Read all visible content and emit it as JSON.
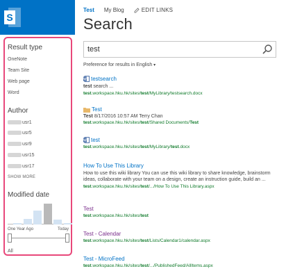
{
  "colors": {
    "brand": "#0072c6",
    "highlight": "#e8477a",
    "url": "#0f7a2a"
  },
  "header": {
    "nav": {
      "current": "Test",
      "blog": "My Blog",
      "edit": "EDIT LINKS"
    },
    "title": "Search"
  },
  "refiners": {
    "result_type": {
      "heading": "Result type",
      "items": [
        "OneNote",
        "Team Site",
        "Web page",
        "Word"
      ]
    },
    "author": {
      "heading": "Author",
      "items": [
        "usr1",
        "usr5",
        "usr9",
        "usr15",
        "usr17"
      ],
      "show_more": "SHOW MORE"
    },
    "modified": {
      "heading": "Modified date",
      "from": "One Year Ago",
      "to": "Today",
      "selection": "All",
      "histogram": [
        0.05,
        0.25,
        0.65,
        1.0,
        0.22,
        0.05
      ]
    }
  },
  "search": {
    "query": "test",
    "preference": "Preference for results in English"
  },
  "results": [
    {
      "icon": "word-doc-icon",
      "title": "testsearch",
      "desc": "test search ...",
      "url": [
        [
          "test",
          "b"
        ],
        [
          ".workspace.hku.hk/sites/",
          ""
        ],
        [
          "test",
          "b"
        ],
        [
          "/MyLibrary/testsearch.docx",
          ""
        ]
      ]
    },
    {
      "icon": "folder-icon",
      "title": "Test",
      "meta": "Test  8/17/2016 10:57 AM Terry Chan",
      "url": [
        [
          "test",
          "b"
        ],
        [
          ".workspace.hku.hk/sites/",
          ""
        ],
        [
          "test",
          "b"
        ],
        [
          "/Shared Documents/",
          ""
        ],
        [
          "Test",
          "b"
        ]
      ]
    },
    {
      "icon": "word-doc-icon",
      "title": "test",
      "url": [
        [
          "test",
          "b"
        ],
        [
          ".workspace.hku.hk/sites/",
          ""
        ],
        [
          "test",
          "b"
        ],
        [
          "/MyLibrary/",
          ""
        ],
        [
          "test",
          "b"
        ],
        [
          ".docx",
          ""
        ]
      ]
    },
    {
      "title": "How To Use This Library",
      "desc": "How to use this wiki library You can use this wiki library to share knowledge, brainstorm ideas, collaborate with your team on a design, create an instruction guide, build an ...",
      "url": [
        [
          "test",
          "b"
        ],
        [
          ".workspace.hku.hk/sites/",
          ""
        ],
        [
          "test",
          "b"
        ],
        [
          "/.../How To Use This Library.aspx",
          ""
        ]
      ]
    },
    {
      "title": "Test",
      "visited": true,
      "url": [
        [
          "test",
          "b"
        ],
        [
          ".workspace.hku.hk/sites/",
          ""
        ],
        [
          "test",
          "b"
        ]
      ]
    },
    {
      "title": "Test - Calendar",
      "visited": true,
      "url": [
        [
          "test",
          "b"
        ],
        [
          ".workspace.hku.hk/sites/",
          ""
        ],
        [
          "test",
          "b"
        ],
        [
          "/Lists/Calendar1/calendar.aspx",
          ""
        ]
      ]
    },
    {
      "title": "Test - MicroFeed",
      "url": [
        [
          "test",
          "b"
        ],
        [
          ".workspace.hku.hk/sites/",
          ""
        ],
        [
          "test",
          "b"
        ],
        [
          "/.../PublishedFeed/AllItems.aspx",
          ""
        ]
      ]
    }
  ]
}
